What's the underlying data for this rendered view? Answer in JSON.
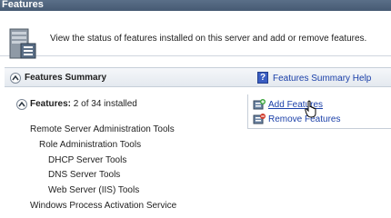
{
  "window": {
    "title": "Features"
  },
  "header": {
    "description": "View the status of features installed on this server and add or remove features."
  },
  "summary": {
    "title": "Features Summary",
    "help_link": "Features Summary Help"
  },
  "features": {
    "label": "Features:",
    "count": "2 of 34 installed"
  },
  "actions": {
    "add": "Add Features",
    "remove": "Remove Features"
  },
  "tree": [
    {
      "label": "Remote Server Administration Tools",
      "level": 0
    },
    {
      "label": "Role Administration Tools",
      "level": 1
    },
    {
      "label": "DHCP Server Tools",
      "level": 2
    },
    {
      "label": "DNS Server Tools",
      "level": 2
    },
    {
      "label": "Web Server (IIS) Tools",
      "level": 2
    },
    {
      "label": "Windows Process Activation Service",
      "level": 0
    }
  ],
  "icons": {
    "server": "server-features-icon",
    "help": "help-icon",
    "add": "add-features-icon",
    "remove": "remove-features-icon",
    "collapse": "collapse-up-icon"
  },
  "colors": {
    "link": "#1a3fa8",
    "titlebar": "#4e627c"
  }
}
